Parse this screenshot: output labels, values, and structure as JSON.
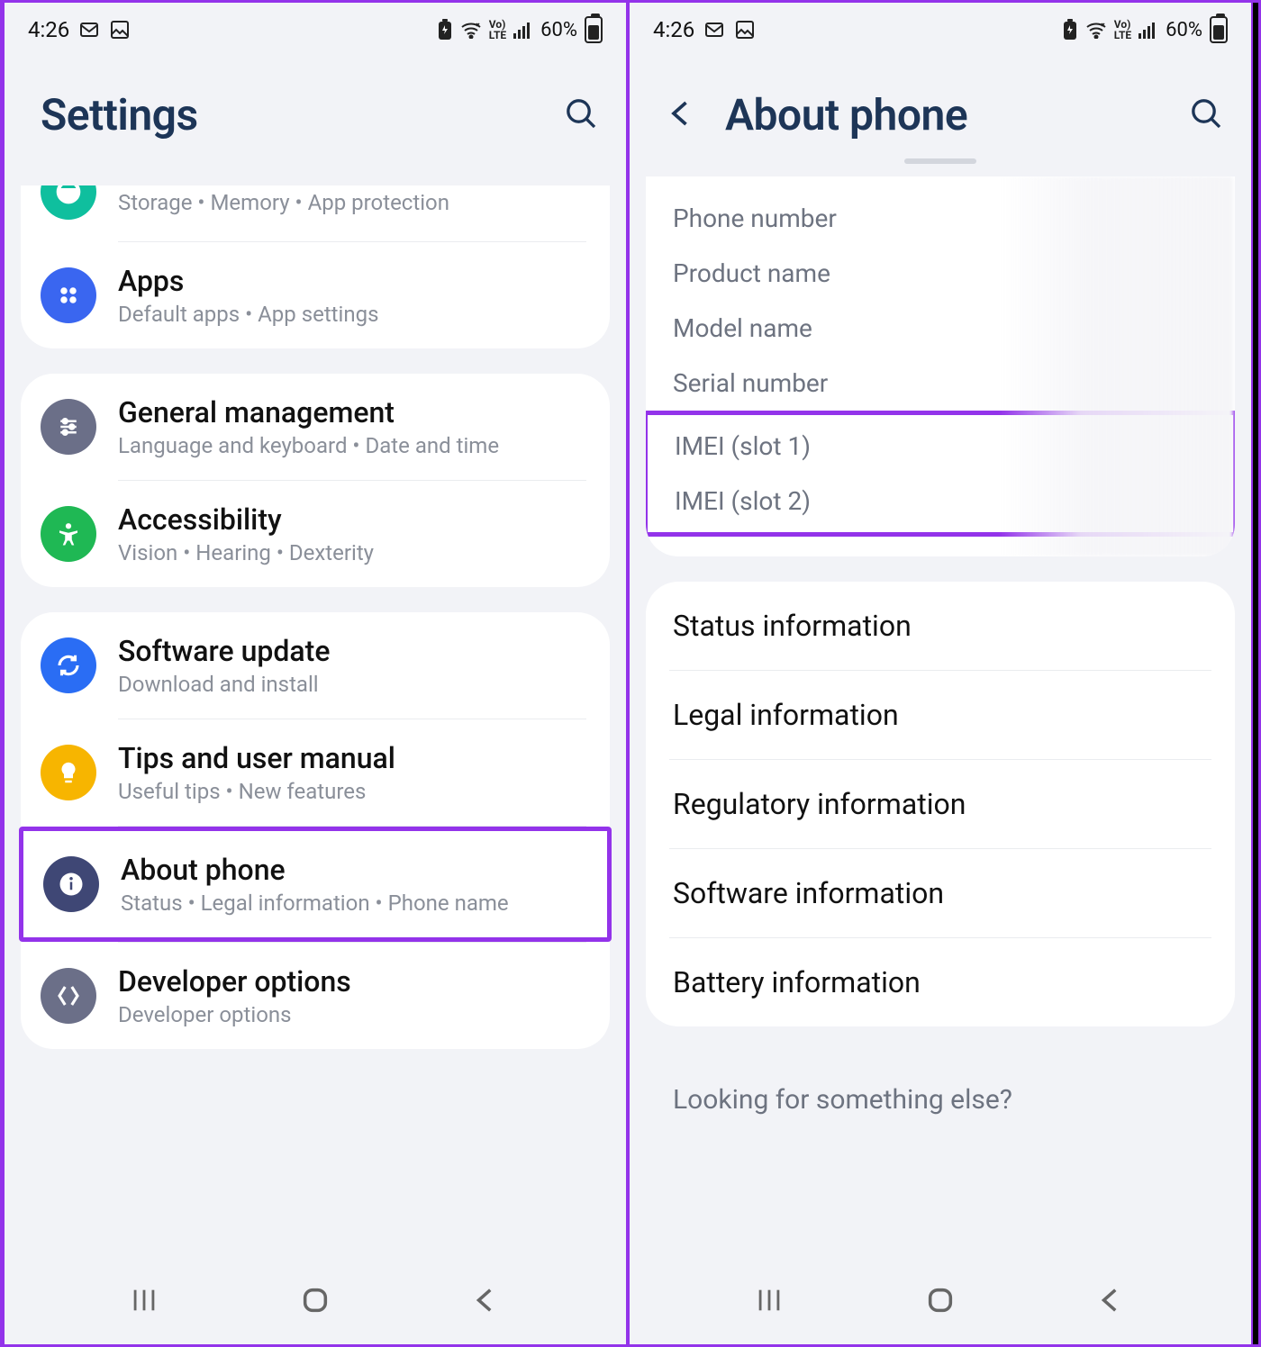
{
  "status": {
    "time": "4:26",
    "battery_pct": "60%"
  },
  "left": {
    "title": "Settings",
    "row_storage_sub": "Storage  •  Memory  •  App protection",
    "apps": {
      "title": "Apps",
      "sub": "Default apps  •  App settings"
    },
    "general": {
      "title": "General management",
      "sub": "Language and keyboard  •  Date and time"
    },
    "accessibility": {
      "title": "Accessibility",
      "sub": "Vision  •  Hearing  •  Dexterity"
    },
    "software": {
      "title": "Software update",
      "sub": "Download and install"
    },
    "tips": {
      "title": "Tips and user manual",
      "sub": "Useful tips  •  New features"
    },
    "about": {
      "title": "About phone",
      "sub": "Status  •  Legal information  •  Phone name"
    },
    "dev": {
      "title": "Developer options",
      "sub": "Developer options"
    }
  },
  "right": {
    "title": "About phone",
    "info": {
      "phone_number": "Phone number",
      "product_name": "Product name",
      "model_name": "Model name",
      "serial_number": "Serial number",
      "imei1": "IMEI (slot 1)",
      "imei2": "IMEI (slot 2)"
    },
    "rows": {
      "status": "Status information",
      "legal": "Legal information",
      "regulatory": "Regulatory information",
      "software": "Software information",
      "battery": "Battery information"
    },
    "footer": "Looking for something else?"
  }
}
